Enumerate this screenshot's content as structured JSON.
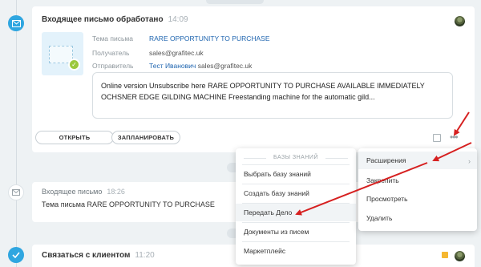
{
  "card_incoming_processed": {
    "title": "Входящее письмо обработано",
    "time": "14:09",
    "subject_label": "Тема письма",
    "subject_value": "RARE OPPORTUNITY TO PURCHASE",
    "recipient_label": "Получатель",
    "recipient_value": "sales@grafitec.uk",
    "sender_label": "Отправитель",
    "sender_name": "Тест Иванович",
    "sender_email": "sales@grafitec.uk",
    "message_line1": "Online version Unsubscribe here RARE OPPORTUNITY TO PURCHASE AVAILABLE IMMEDIATELY",
    "message_line2": "OCHSNER EDGE GILDING MACHINE Freestanding machine for the automatic gild...",
    "open_button": "ОТКРЫТЬ",
    "schedule_button": "ЗАПЛАНИРОВАТЬ"
  },
  "knowledge_menu": {
    "header": "БАЗЫ ЗНАНИЙ",
    "items": [
      "Выбрать базу знаний",
      "Создать базу знаний",
      "Передать Дело",
      "Документы из писем",
      "Маркетплейс"
    ]
  },
  "extensions_menu": {
    "items": [
      "Расширения",
      "Закрепить",
      "Просмотреть",
      "Удалить"
    ]
  },
  "card_incoming": {
    "title": "Входящее письмо",
    "time": "18:26",
    "subject_text": "Тема письма RARE OPPORTUNITY TO PURCHASE"
  },
  "card_contact": {
    "title": "Связаться с клиентом",
    "time": "11:20"
  },
  "colors": {
    "accent_blue": "#2fa6e0",
    "link_blue": "#2066b0",
    "arrow_red": "#d62020",
    "flag_yellow": "#f5b731"
  }
}
